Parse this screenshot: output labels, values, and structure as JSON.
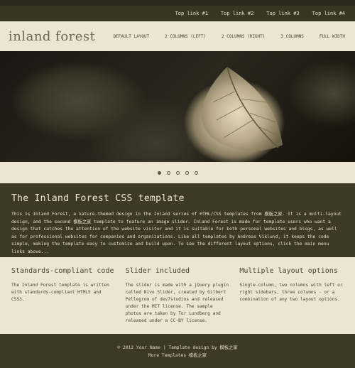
{
  "top_links": [
    "Top link #1",
    "Top link #2",
    "Top link #3",
    "Top link #4"
  ],
  "logo": "inland forest",
  "nav": [
    "DEFAULT LAYOUT",
    "2 COLUMNS (LEFT)",
    "2 COLUMNS (RIGHT)",
    "3 COLUMNS",
    "FULL WIDTH"
  ],
  "slider": {
    "dots": 5,
    "active_index": 0
  },
  "intro": {
    "title": "The Inland Forest CSS template",
    "body": "This is Inland Forest, a nature-themed design in the Inland series of HTML/CSS templates from 模板之家. It is a multi-layout design, and the second 模板之家 template to feature an image slider. Inland Forest is made for template users who want a design that catches the attention of the website visitor and it is suitable for both personal websites and blogs, as well as for professional websites for companies and organizations. Like all templates by Andreas Viklund, it keeps the code simple, making the template easy to customize and build upon. To see the different layout options, click the main menu links above..."
  },
  "columns": [
    {
      "title": "Standards-compliant code",
      "body": "The Inland Forest template is written with standards-compliant HTML5 and CSS3."
    },
    {
      "title": "Slider included",
      "body": "The slider is made with a jQuery plugin called Nivo Slider, created by Gilbert Pellegrom of dev7studios and released under the MIT license. The sample photos are taken by Tor Lundberg and released under a CC-BY license."
    },
    {
      "title": "Multiple layout options",
      "body": "Single-column, two columns with left or right sidebars, three columns - or a combination of any two layout options."
    }
  ],
  "footer": {
    "line1": "© 2012 Your Name | Template design by 模板之家",
    "line2": "More Templates 模板之家"
  }
}
